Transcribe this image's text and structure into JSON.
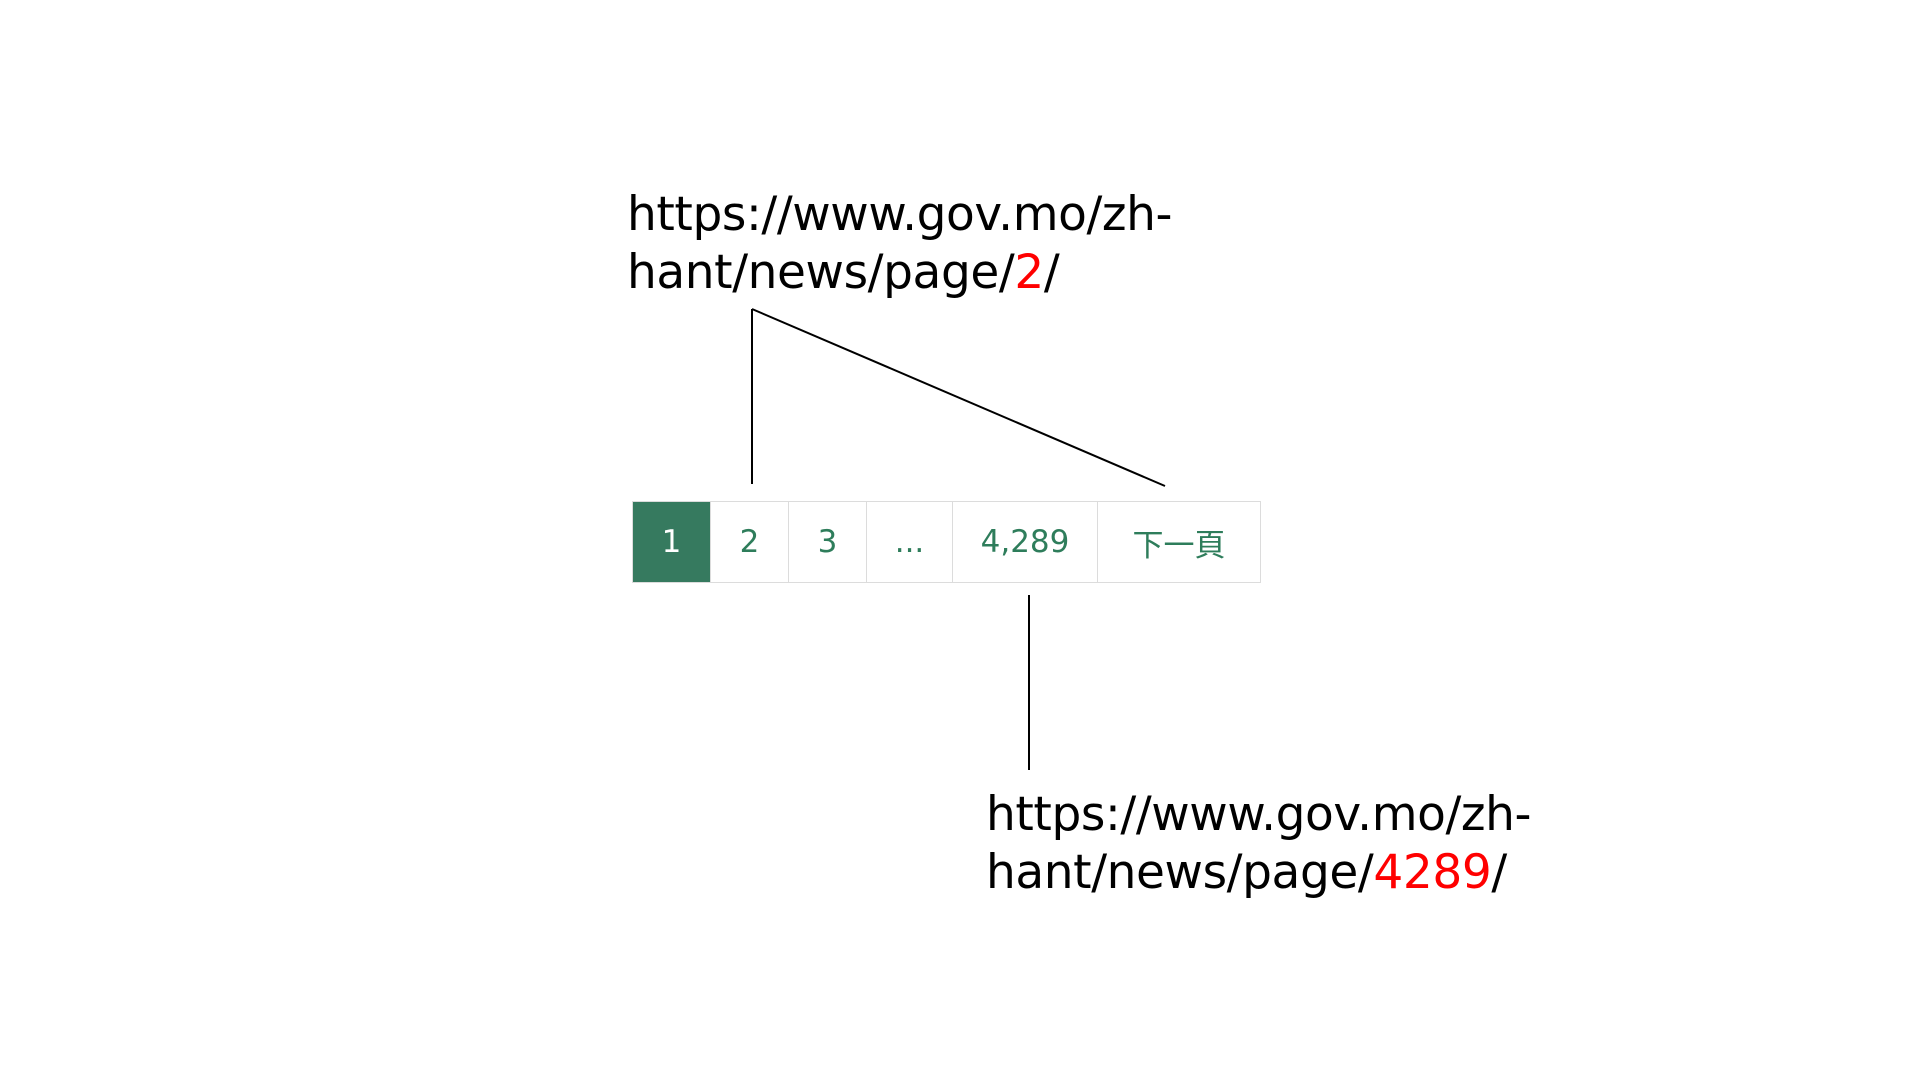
{
  "annotations": {
    "top_url": {
      "line1": "https://www.gov.mo/zh-",
      "line2_prefix": "hant/news/page/",
      "highlight": "2",
      "suffix": "/"
    },
    "bottom_url": {
      "line1": "https://www.gov.mo/zh-",
      "line2_prefix": "hant/news/page/",
      "highlight": "4289",
      "suffix": "/"
    }
  },
  "pagination": {
    "items": [
      {
        "label": "1",
        "active": true
      },
      {
        "label": "2",
        "active": false
      },
      {
        "label": "3",
        "active": false
      },
      {
        "label": "...",
        "active": false
      },
      {
        "label": "4,289",
        "active": false
      },
      {
        "label": "下一頁",
        "active": false
      }
    ]
  },
  "colors": {
    "active_bg": "#367a5f",
    "link_text": "#2e7d5b",
    "highlight": "#ff0000",
    "border": "#dcdcdc"
  }
}
